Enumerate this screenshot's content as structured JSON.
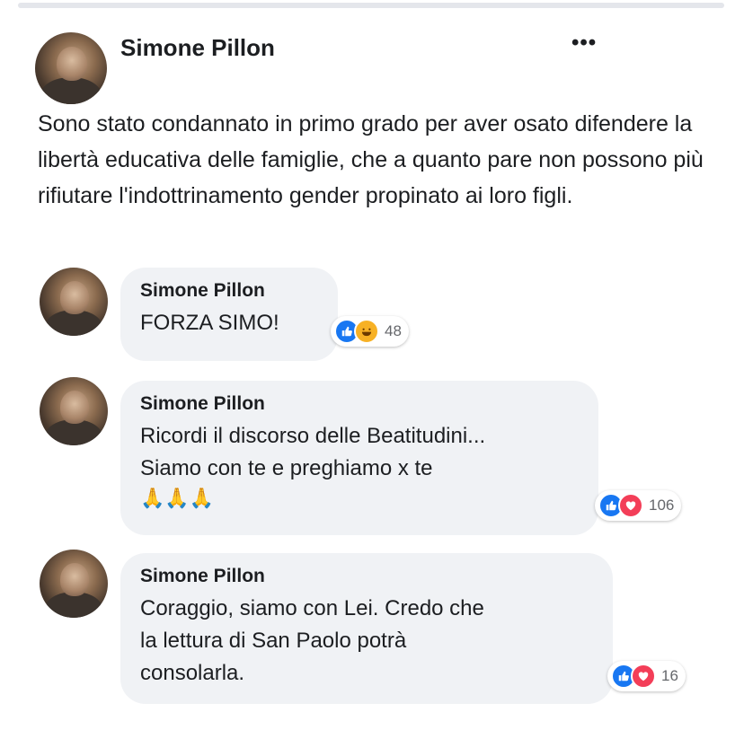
{
  "post": {
    "author": "Simone Pillon",
    "more_icon": "more-horizontal-icon",
    "text": "Sono stato condannato in primo grado per aver osato difendere la libertà educativa delle famiglie, che a quanto pare non possono più rifiutare l'indottrinamento gender propinato ai loro figli."
  },
  "comments": [
    {
      "author": "Simone Pillon",
      "text": "FORZA SIMO!",
      "reactions": [
        "like",
        "haha"
      ],
      "count": "48"
    },
    {
      "author": "Simone Pillon",
      "text": "Ricordi il discorso delle Beatitudini...\nSiamo con te e preghiamo x te",
      "emoji": "🙏🙏🙏",
      "reactions": [
        "like",
        "love"
      ],
      "count": "106"
    },
    {
      "author": "Simone Pillon",
      "text": "Coraggio, siamo con Lei. Credo che\nla lettura di San Paolo potrà\nconsolarla.",
      "reactions": [
        "like",
        "love"
      ],
      "count": "16"
    }
  ],
  "colors": {
    "like": "#1877f2",
    "love": "#f33e58",
    "haha": "#f7b125",
    "bubble": "#f0f2f5"
  }
}
